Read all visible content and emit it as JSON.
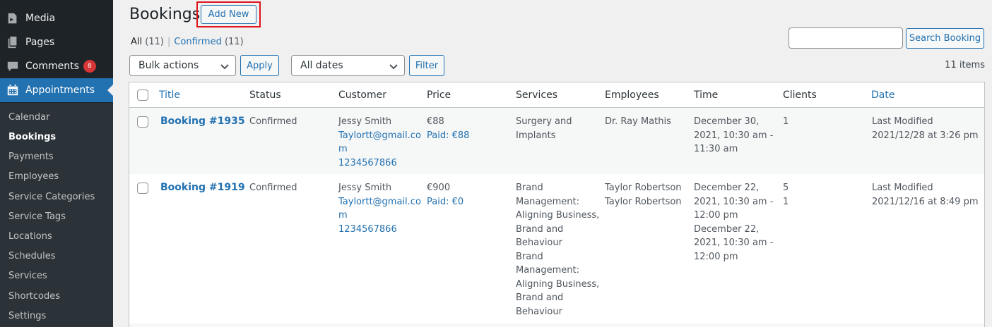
{
  "sidebar": {
    "menu": [
      {
        "label": "Media",
        "icon": "media-icon"
      },
      {
        "label": "Pages",
        "icon": "pages-icon"
      },
      {
        "label": "Comments",
        "icon": "comments-icon",
        "badge": "8"
      },
      {
        "label": "Appointments",
        "icon": "calendar-icon",
        "current": true
      }
    ],
    "submenu": [
      "Calendar",
      "Bookings",
      "Payments",
      "Employees",
      "Service Categories",
      "Service Tags",
      "Locations",
      "Schedules",
      "Services",
      "Shortcodes",
      "Settings"
    ]
  },
  "header": {
    "title": "Bookings",
    "add_new_label": "Add New"
  },
  "views": {
    "all_label": "All",
    "all_count": "(11)",
    "separator": "|",
    "confirmed_label": "Confirmed",
    "confirmed_count": "(11)"
  },
  "search": {
    "value": "",
    "button_label": "Search Booking"
  },
  "filters": {
    "bulk_selected": "Bulk actions",
    "apply_label": "Apply",
    "dates_selected": "All dates",
    "filter_label": "Filter",
    "items_count": "11 items"
  },
  "table": {
    "columns": [
      "Title",
      "Status",
      "Customer",
      "Price",
      "Services",
      "Employees",
      "Time",
      "Clients",
      "Date"
    ],
    "rows": [
      {
        "title": "Booking #1935",
        "status": "Confirmed",
        "customer_name": "Jessy Smith",
        "customer_email_1": "Taylortt@gmail.co",
        "customer_email_2": "m",
        "customer_phone": "1234567866",
        "price": "€88",
        "paid": "Paid: €88",
        "services": [
          "Surgery and",
          "Implants"
        ],
        "employees": [
          "Dr. Ray Mathis"
        ],
        "time": [
          "December 30,",
          "2021, 10:30 am -",
          "11:30 am"
        ],
        "clients": [
          "1"
        ],
        "date_1": "Last Modified",
        "date_2": "2021/12/28 at 3:26 pm"
      },
      {
        "title": "Booking #1919",
        "status": "Confirmed",
        "customer_name": "Jessy Smith",
        "customer_email_1": "Taylortt@gmail.co",
        "customer_email_2": "m",
        "customer_phone": "1234567866",
        "price": "€900",
        "paid": "Paid: €0",
        "services": [
          "Brand",
          "Management:",
          "Aligning Business,",
          "Brand and",
          "Behaviour",
          "Brand",
          "Management:",
          "Aligning Business,",
          "Brand and",
          "Behaviour"
        ],
        "employees": [
          "Taylor Robertson",
          "Taylor Robertson"
        ],
        "time": [
          "December 22,",
          "2021, 10:30 am -",
          "12:00 pm",
          "December 22,",
          "2021, 10:30 am -",
          "12:00 pm"
        ],
        "clients": [
          "5",
          "1"
        ],
        "date_1": "Last Modified",
        "date_2": "2021/12/16 at 8:49 pm"
      }
    ]
  },
  "colors": {
    "sidebar_bg": "#1d2327",
    "accent": "#2271b1",
    "badge": "#d63638",
    "highlight": "#e0141e"
  }
}
